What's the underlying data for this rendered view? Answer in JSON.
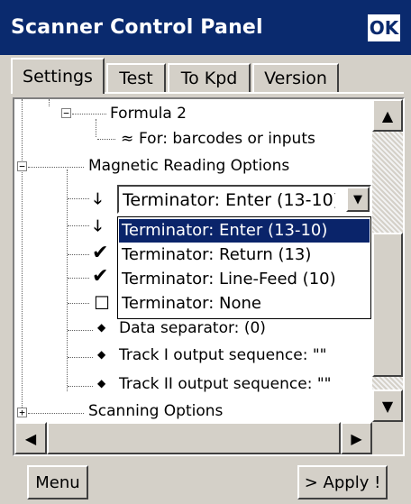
{
  "window": {
    "title": "Scanner Control Panel",
    "ok_label": "OK"
  },
  "tabs": [
    {
      "label": "Settings",
      "active": true
    },
    {
      "label": "Test",
      "active": false
    },
    {
      "label": "To Kpd",
      "active": false
    },
    {
      "label": "Version",
      "active": false
    }
  ],
  "tree": {
    "formula2": "Formula 2",
    "for_inputs": "For: barcodes or inputs",
    "magnetic": "Magnetic Reading Options",
    "data_separator": "Data separator: (0)",
    "track1": "Track I output sequence: \"\"",
    "track2": "Track II output sequence: \"\"",
    "scanning": "Scanning Options"
  },
  "combo": {
    "value": "Terminator: Enter (13-10)",
    "options": [
      {
        "label": "Terminator: Enter (13-10)",
        "selected": true
      },
      {
        "label": "Terminator: Return (13)",
        "selected": false
      },
      {
        "label": "Terminator: Line-Feed (10)",
        "selected": false
      },
      {
        "label": "Terminator: None",
        "selected": false
      }
    ]
  },
  "icons": {
    "arrow": "down-arrow-icon",
    "check": "checkmark-icon",
    "empty": "empty-checkbox-icon",
    "bullet": "diamond-bullet-icon",
    "approx": "approx-icon"
  },
  "buttons": {
    "menu": "Menu",
    "apply": "> Apply !"
  },
  "colors": {
    "titlebar": "#0a2a6e",
    "selection": "#0a246a",
    "face": "#d4d0c8"
  }
}
